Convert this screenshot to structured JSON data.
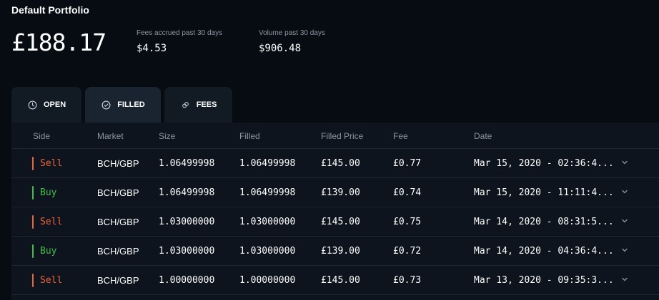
{
  "header": {
    "title": "Default Portfolio",
    "balance": "£188.17",
    "fees_label": "Fees accrued past 30 days",
    "fees_value": "$4.53",
    "volume_label": "Volume past 30 days",
    "volume_value": "$906.48"
  },
  "tabs": [
    {
      "label": "OPEN",
      "icon": "clock-icon",
      "active": false
    },
    {
      "label": "FILLED",
      "icon": "check-circle-icon",
      "active": true
    },
    {
      "label": "FEES",
      "icon": "coins-icon",
      "active": false
    }
  ],
  "table": {
    "columns": [
      "Side",
      "Market",
      "Size",
      "Filled",
      "Filled Price",
      "Fee",
      "Date"
    ],
    "rows": [
      {
        "side": "Sell",
        "market": "BCH/GBP",
        "size": "1.06499998",
        "filled": "1.06499998",
        "price": "£145.00",
        "fee": "£0.77",
        "date": "Mar 15, 2020 - 02:36:4..."
      },
      {
        "side": "Buy",
        "market": "BCH/GBP",
        "size": "1.06499998",
        "filled": "1.06499998",
        "price": "£139.00",
        "fee": "£0.74",
        "date": "Mar 15, 2020 - 11:11:4..."
      },
      {
        "side": "Sell",
        "market": "BCH/GBP",
        "size": "1.03000000",
        "filled": "1.03000000",
        "price": "£145.00",
        "fee": "£0.75",
        "date": "Mar 14, 2020 - 08:31:5..."
      },
      {
        "side": "Buy",
        "market": "BCH/GBP",
        "size": "1.03000000",
        "filled": "1.03000000",
        "price": "£139.00",
        "fee": "£0.72",
        "date": "Mar 14, 2020 - 04:36:4..."
      },
      {
        "side": "Sell",
        "market": "BCH/GBP",
        "size": "1.00000000",
        "filled": "1.00000000",
        "price": "£145.00",
        "fee": "£0.73",
        "date": "Mar 13, 2020 - 09:35:3..."
      }
    ]
  },
  "colors": {
    "sell": "#f0643c",
    "buy": "#3fbf4a",
    "background": "#070c12",
    "table_bg": "#0d141d"
  }
}
